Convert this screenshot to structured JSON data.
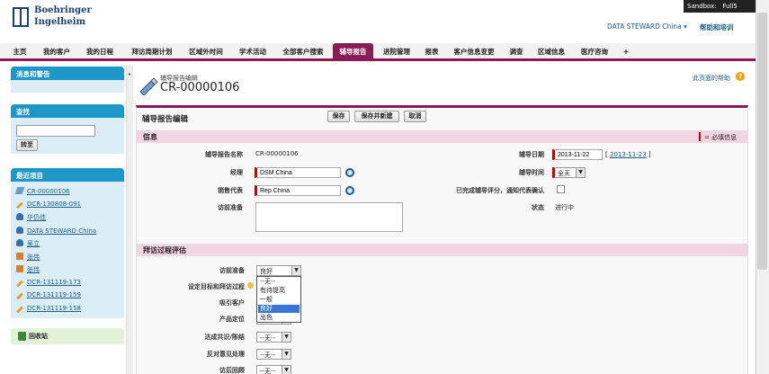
{
  "header": {
    "logo_line1": "Boehringer",
    "logo_line2": "Ingelheim",
    "sandbox": "Sandbox:",
    "sandbox_name": "Full5",
    "user_menu": "DATA STEWARD China ▾",
    "help_training": "帮助和培训"
  },
  "tabs": [
    {
      "label": "主页"
    },
    {
      "label": "我的客户"
    },
    {
      "label": "我的日程"
    },
    {
      "label": "拜访周期计划"
    },
    {
      "label": "区域外时间"
    },
    {
      "label": "学术活动"
    },
    {
      "label": "全部客户搜索"
    },
    {
      "label": "辅导报告"
    },
    {
      "label": "进院管理"
    },
    {
      "label": "报表"
    },
    {
      "label": "客户信息变更"
    },
    {
      "label": "调查"
    },
    {
      "label": "区域信息"
    },
    {
      "label": "医疗咨询"
    },
    {
      "label": "+"
    }
  ],
  "sidebar": {
    "messages_title": "消息和警告",
    "search_title": "查找",
    "search_value": "",
    "go_button": "转至",
    "recent_title": "最近项目",
    "recent_items": [
      {
        "label": "CR-00000106",
        "icon": "coaching-report-icon"
      },
      {
        "label": "DCR-130808-091",
        "icon": "pencil-icon"
      },
      {
        "label": "华仍佳",
        "icon": "person-icon"
      },
      {
        "label": "DATA STEWARD China",
        "icon": "person-icon"
      },
      {
        "label": "吴立",
        "icon": "person-icon"
      },
      {
        "label": "张伟",
        "icon": "badge-icon"
      },
      {
        "label": "张伟",
        "icon": "badge-icon"
      },
      {
        "label": "DCR-131119-173",
        "icon": "pencil-icon"
      },
      {
        "label": "DCR-131119-159",
        "icon": "pencil-icon"
      },
      {
        "label": "DCR-131119-158",
        "icon": "pencil-icon"
      }
    ],
    "recycle_bin": "回收站"
  },
  "page": {
    "subtitle": "辅导报告编辑",
    "title": "CR-00000106",
    "help_link": "此页面的帮助",
    "help_icon": "?"
  },
  "form": {
    "title": "辅导报告编辑",
    "save": "保存",
    "save_new": "保存并新建",
    "cancel": "取消",
    "info_section": "信息",
    "required_note": "= 必填信息",
    "name_label": "辅导报告名称",
    "name_value": "CR-00000106",
    "manager_label": "经理",
    "manager_value": "DSM China",
    "rep_label": "销售代表",
    "rep_value": "Rep China",
    "prep_label": "访前准备",
    "date_label": "辅导日期",
    "date_value": "2013-11-22",
    "date_today": "2013-11-23",
    "time_label": "辅导时间",
    "time_value": "全天",
    "confirm_label": "已完成辅导评分，通知代表确认",
    "status_label": "状态",
    "status_value": "进行中",
    "eval_section": "拜访过程评估",
    "eval_rows": [
      {
        "label": "访前准备",
        "value": "良好"
      },
      {
        "label": "设定目标和拜访过程",
        "value": "--无--"
      },
      {
        "label": "吸引客户",
        "value": "--无--"
      },
      {
        "label": "产品定位",
        "value": "--无--"
      },
      {
        "label": "达成共识/陈结",
        "value": "--无--"
      },
      {
        "label": "反对意见处理",
        "value": "--无--"
      },
      {
        "label": "访后回顾",
        "value": "--无--"
      }
    ],
    "dropdown_options": [
      "--无--",
      "有待提高",
      "一般",
      "良好",
      "出色"
    ],
    "dropdown_selected": "良好"
  },
  "colors": {
    "accent": "#8a1b54",
    "sidebar": "#1c97c8",
    "section": "#f2d5e2"
  }
}
